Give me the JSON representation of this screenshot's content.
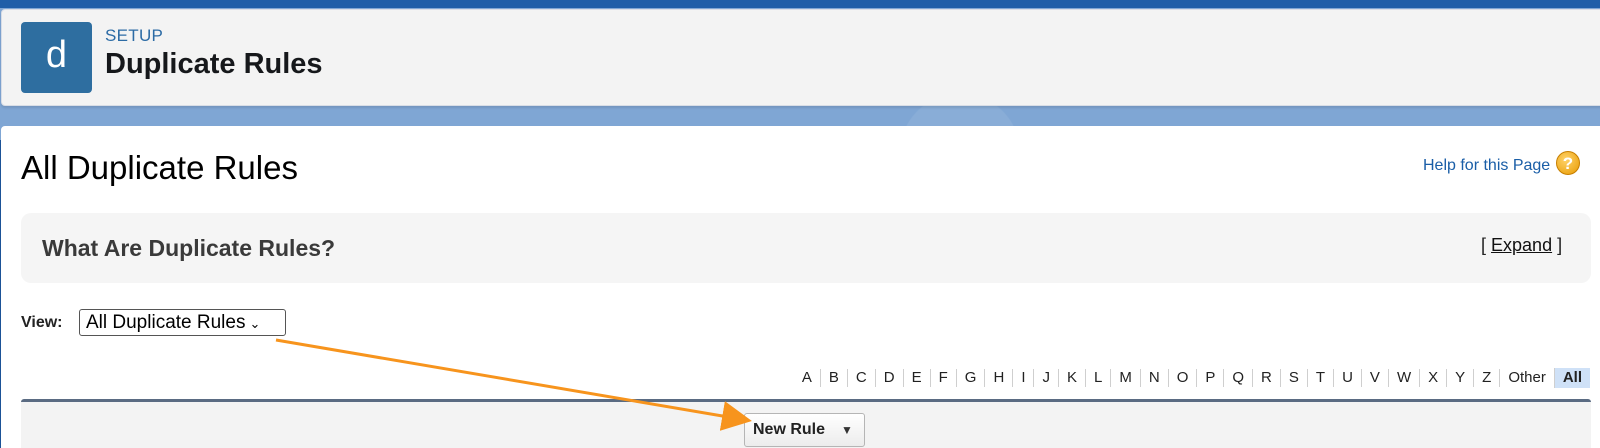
{
  "header": {
    "icon_letter": "d",
    "eyebrow": "SETUP",
    "title": "Duplicate Rules"
  },
  "page": {
    "title": "All Duplicate Rules",
    "help_link": "Help for this Page",
    "help_icon": "question-icon"
  },
  "info": {
    "title": "What Are Duplicate Rules?",
    "bracket_open": "[",
    "expand_label": "Expand",
    "bracket_close": "]"
  },
  "view": {
    "label": "View:",
    "selected": "All Duplicate Rules"
  },
  "alphabet": [
    "A",
    "B",
    "C",
    "D",
    "E",
    "F",
    "G",
    "H",
    "I",
    "J",
    "K",
    "L",
    "M",
    "N",
    "O",
    "P",
    "Q",
    "R",
    "S",
    "T",
    "U",
    "V",
    "W",
    "X",
    "Y",
    "Z",
    "Other",
    "All"
  ],
  "alphabet_active": "All",
  "list": {
    "new_rule_label": "New Rule"
  },
  "colors": {
    "brand_blue": "#2e6ea0",
    "annotation_arrow": "#f7941d"
  }
}
